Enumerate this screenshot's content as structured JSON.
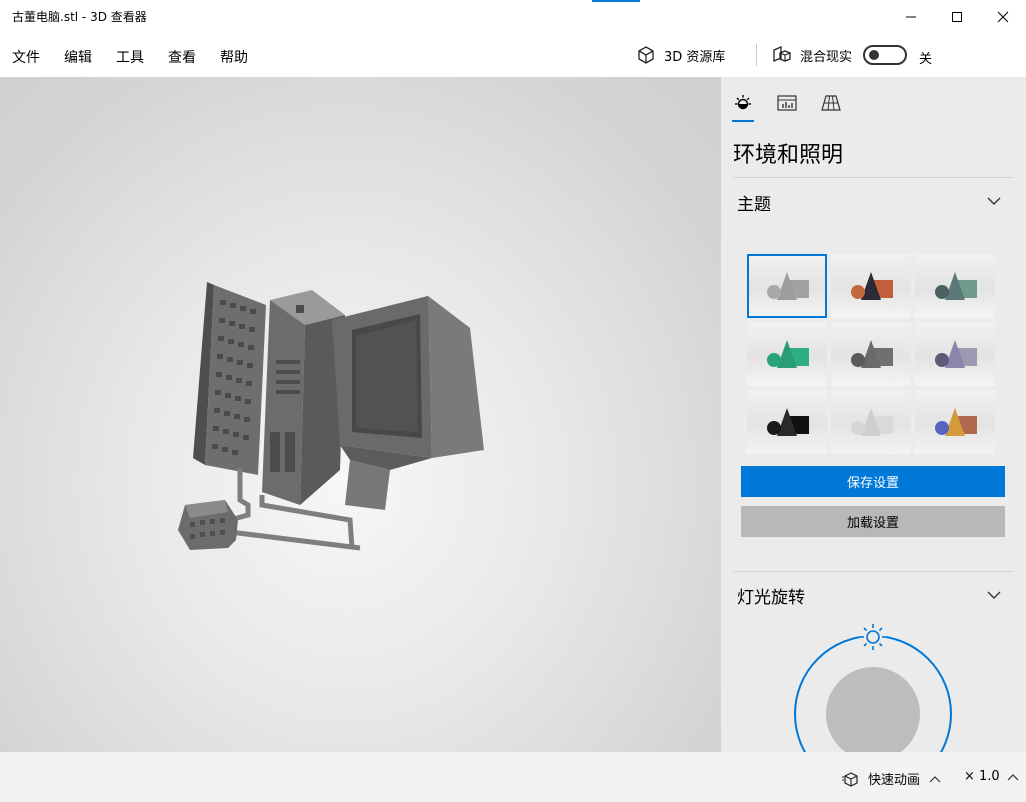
{
  "window": {
    "title": "古董电脑.stl - 3D 查看器"
  },
  "menu": {
    "file": "文件",
    "edit": "编辑",
    "tools": "工具",
    "view": "查看",
    "help": "帮助"
  },
  "toolbar": {
    "library_label": "3D 资源库",
    "mixed_reality_label": "混合现实",
    "mixed_reality_state": "关"
  },
  "panel": {
    "title": "环境和照明",
    "theme_section": "主题",
    "save_button": "保存设置",
    "load_button": "加载设置",
    "light_section": "灯光旋转"
  },
  "themes": [
    {
      "sphere": "#a9a9a9",
      "cone": "#9d9d9d",
      "box": "#a2a2a2"
    },
    {
      "sphere": "#c06a3a",
      "cone": "#2a2a38",
      "box": "#c0603a"
    },
    {
      "sphere": "#4d6060",
      "cone": "#5c7878",
      "box": "#6f9a8c"
    },
    {
      "sphere": "#2aa37c",
      "cone": "#2a9c78",
      "box": "#2fae86"
    },
    {
      "sphere": "#5a5a5a",
      "cone": "#6a6a6a",
      "box": "#707070"
    },
    {
      "sphere": "#5e5a7a",
      "cone": "#8a86ab",
      "box": "#9e98b3"
    },
    {
      "sphere": "#1a1a1a",
      "cone": "#2a2a2a",
      "box": "#111111"
    },
    {
      "sphere": "#d6d6d6",
      "cone": "#cfcfcf",
      "box": "#d9d9d9"
    },
    {
      "sphere": "#5a64c0",
      "cone": "#d59a3c",
      "box": "#b06a4e"
    }
  ],
  "bottom": {
    "quick_animation": "快速动画",
    "speed": "× 1.0"
  },
  "colors": {
    "accent": "#0078d7",
    "model_gray": "#7a7a7a"
  }
}
